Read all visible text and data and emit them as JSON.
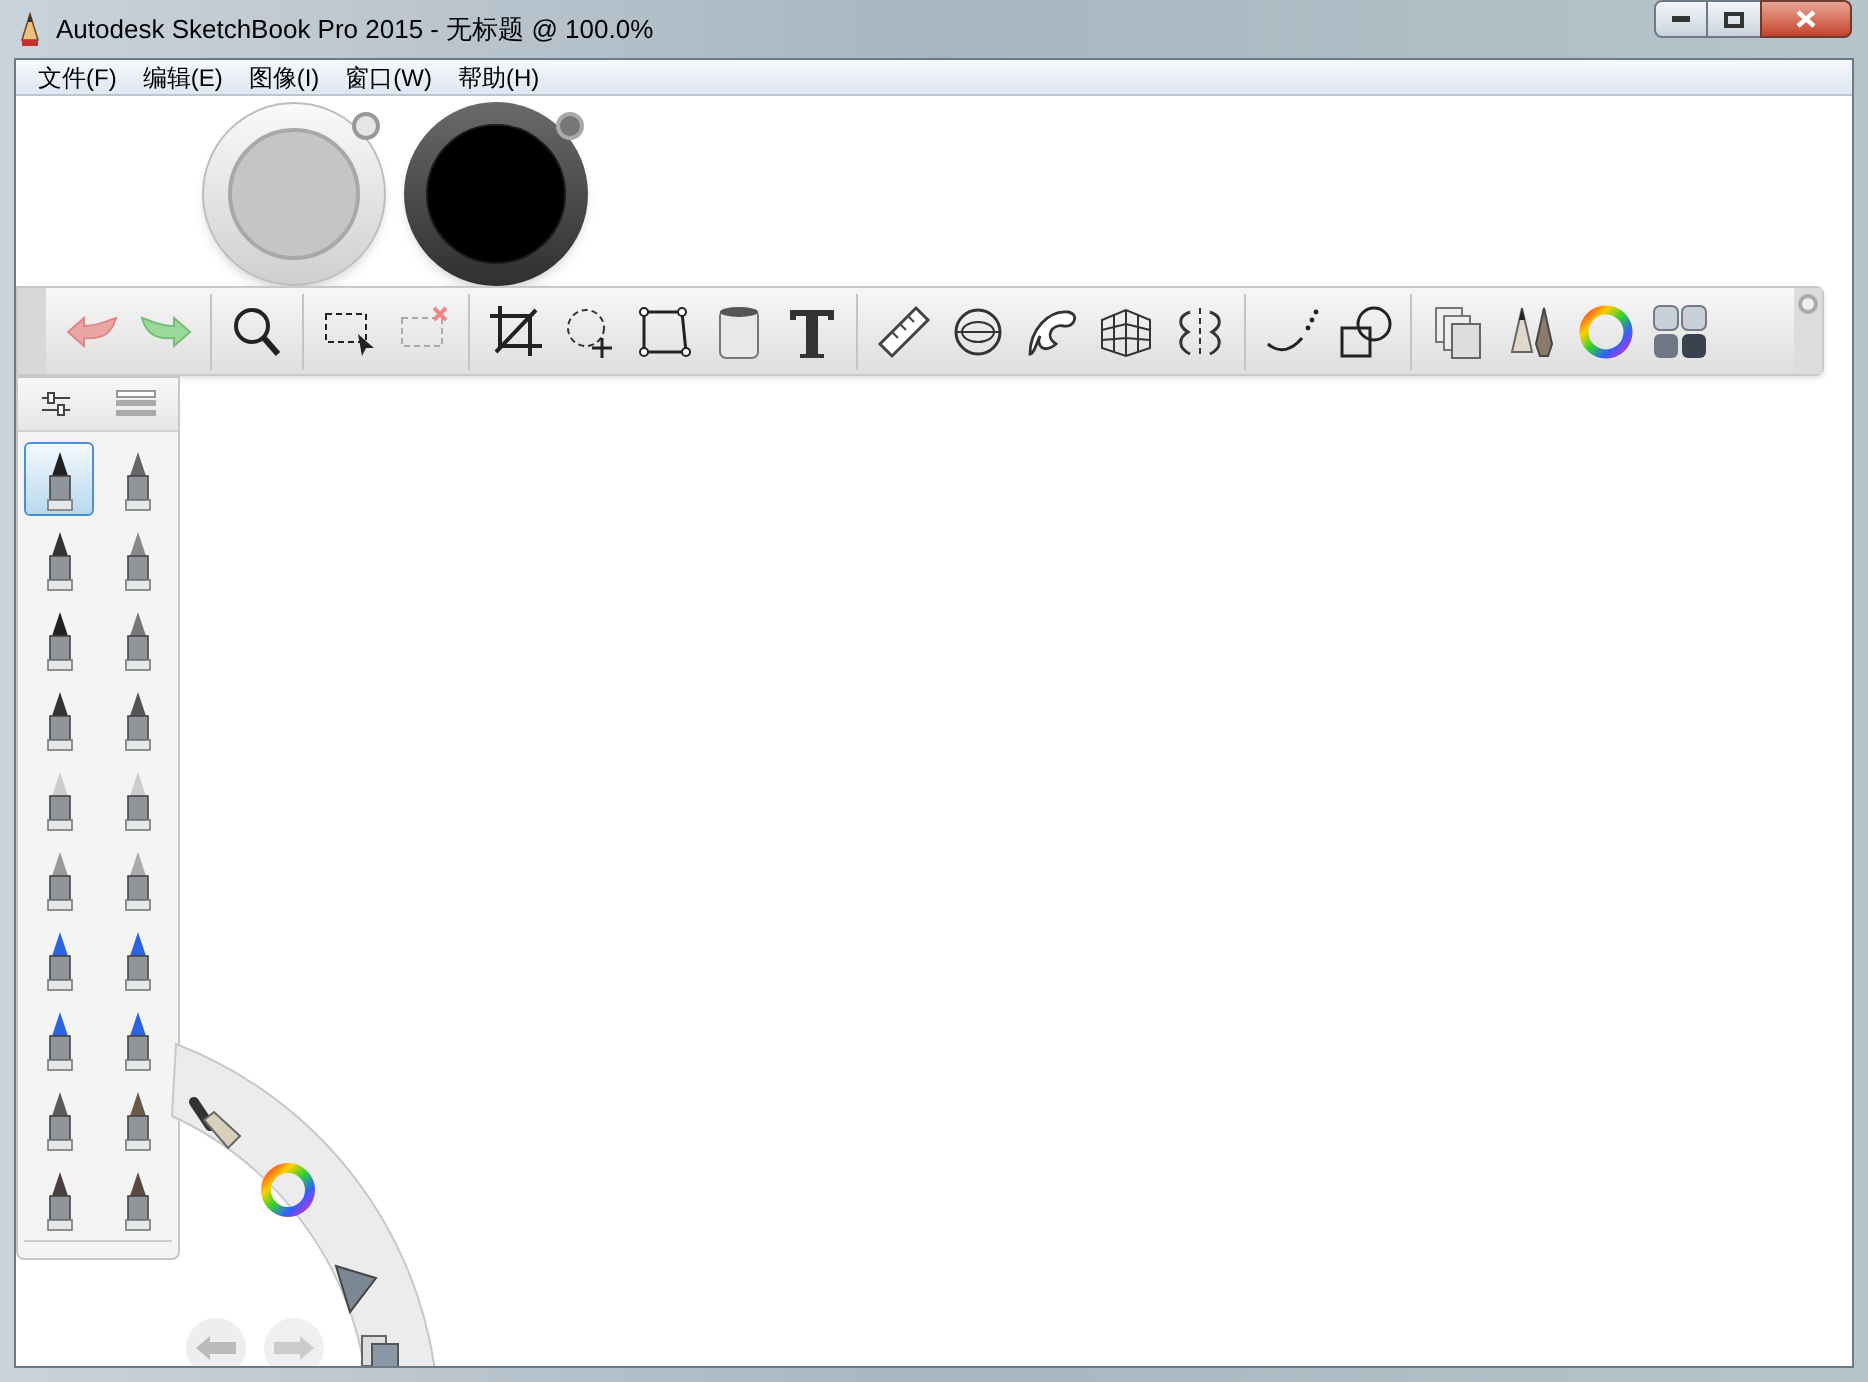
{
  "window": {
    "title": "Autodesk SketchBook Pro 2015 - 无标题 @ 100.0%"
  },
  "menu": [
    {
      "label": "文件(F)"
    },
    {
      "label": "编辑(E)"
    },
    {
      "label": "图像(I)"
    },
    {
      "label": "窗口(W)"
    },
    {
      "label": "帮助(H)"
    }
  ],
  "brushes": [
    {
      "selected": true
    },
    {
      "selected": false
    },
    {
      "selected": false
    },
    {
      "selected": false
    },
    {
      "selected": false
    },
    {
      "selected": false
    },
    {
      "selected": false
    },
    {
      "selected": false
    },
    {
      "selected": false
    },
    {
      "selected": false
    },
    {
      "selected": false
    },
    {
      "selected": false
    },
    {
      "selected": false
    },
    {
      "selected": false
    },
    {
      "selected": false
    },
    {
      "selected": false
    },
    {
      "selected": false
    },
    {
      "selected": false
    },
    {
      "selected": false
    },
    {
      "selected": false
    }
  ]
}
